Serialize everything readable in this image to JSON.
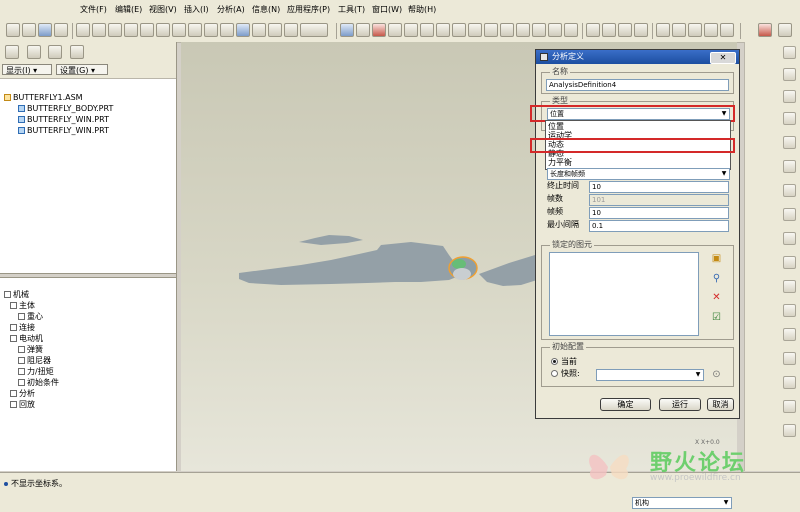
{
  "menu": [
    "文件(F)",
    "编辑(E)",
    "视图(V)",
    "插入(I)",
    "分析(A)",
    "信息(N)",
    "应用程序(P)",
    "工具(T)",
    "窗口(W)",
    "帮助(H)"
  ],
  "left_panel": {
    "show_label": "显示(I) ▾",
    "settings_label": "设置(G) ▾",
    "model_tree": [
      "BUTTERFLY1.ASM",
      "BUTTERFLY_BODY.PRT",
      "BUTTERFLY_WIN.PRT",
      "BUTTERFLY_WIN.PRT"
    ],
    "mechanism_tree": [
      "机械",
      "主体",
      "重心",
      "连接",
      "电动机",
      "弹簧",
      "阻尼器",
      "力/扭矩",
      "初始条件",
      "分析",
      "回放"
    ]
  },
  "dialog": {
    "title": "分析定义",
    "close_label": "✕",
    "name_group": "名称",
    "name_value": "AnalysisDefinition4",
    "type_group": "类型",
    "type_selected": "位置",
    "type_options": [
      "位置",
      "运动学",
      "动态",
      "静态",
      "力平衡"
    ],
    "preference_combo": "长度和帧频",
    "fields": [
      {
        "label": "终止时间",
        "value": "10",
        "disabled": false
      },
      {
        "label": "帧数",
        "value": "101",
        "disabled": true
      },
      {
        "label": "帧频",
        "value": "10",
        "disabled": false
      },
      {
        "label": "最小间隔",
        "value": "0.1",
        "disabled": false
      }
    ],
    "locked_group": "锁定的图元",
    "init_group": "初始配置",
    "current_label": "当前",
    "snapshot_label": "快照:",
    "ok_label": "确定",
    "run_label": "运行",
    "cancel_label": "取消"
  },
  "status": {
    "message": "不显示坐标系。",
    "filter_value": "机构",
    "watermark": "野火论坛",
    "watermark_url": "www.proewildfire.cn",
    "coord_text": "X X+0.0"
  },
  "colors": {
    "accent": "#d42929",
    "titlebar": "#1c4ea0",
    "viewport": "#d8d7c6",
    "model": "#94a0a7"
  }
}
